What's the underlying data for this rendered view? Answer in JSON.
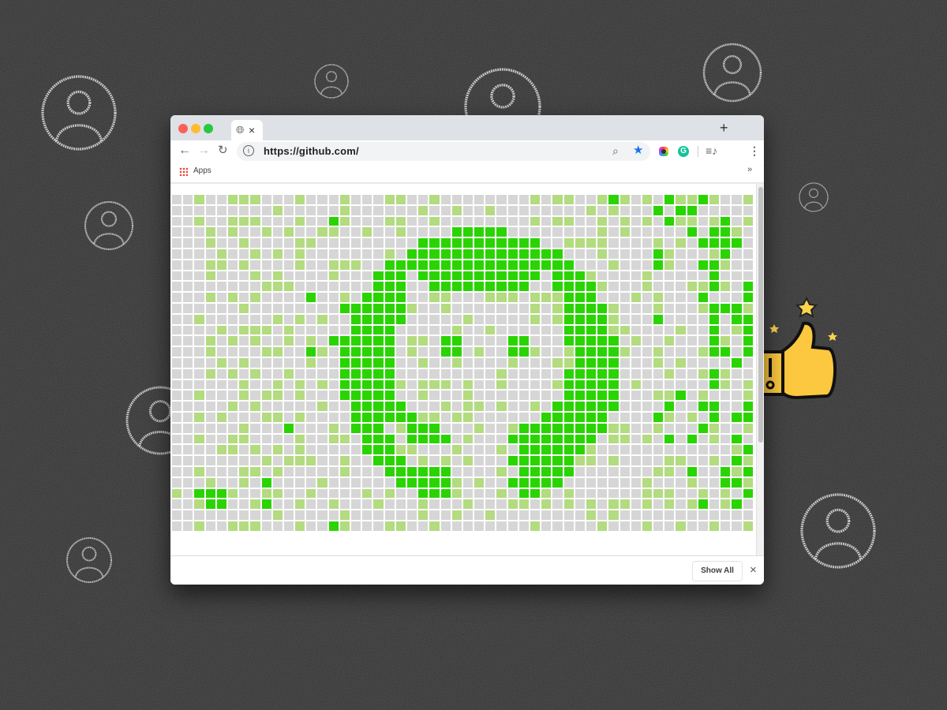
{
  "browser": {
    "tab_close": "×",
    "new_tab": "+",
    "url": "https://github.com/",
    "bookmarks": {
      "apps_label": "Apps",
      "more": "»"
    },
    "bottom_bar": {
      "show_all_label": "Show All",
      "close": "×"
    }
  },
  "colors": {
    "empty": "#d6d6d6",
    "light": "#b3db80",
    "bright": "#2ad400",
    "traffic_close": "#ff5f57",
    "traffic_min": "#febc2e",
    "traffic_max": "#28c840",
    "bookmark_star": "#1a73e8"
  },
  "icons": [
    "globe-icon",
    "back-arrow-icon",
    "forward-arrow-icon",
    "reload-icon",
    "info-icon",
    "zoom-icon",
    "bookmark-star-icon",
    "extension-color-icon",
    "grammarly-icon",
    "media-playlist-icon",
    "menu-kebab-icon",
    "apps-grid-icon",
    "user-circle-icon",
    "thumbs-up-icon"
  ],
  "contribution_grid": {
    "rows": [
      "0010011100010001000110010000000010110012101021121001",
      "0000000001000001000000100100100000000101000202200000",
      "0010011100010021000110010000000010110010101021101201",
      "0001010010100110010010000222220000000010100000202210",
      "0001001000011000000000222222222220011110000101022220",
      "0000100101010000000102222222222222200010000210001200",
      "0001101000010011100222222222222222220001000210022100",
      "0001000101000010002220222222222220222100001000002000",
      "0000000011100000002220022222222200222210001000112102",
      "0001010100002001022220011000111011122200010100020002",
      "0000001000000002222221001000000010122221000100012221",
      "0010000001010100222220000010000010122221000200002022",
      "0000101110100000222200000100100000022221100001002012",
      "0001010100101022222201102200002200022222010010002102",
      "0001000011002102222201002201002210012222100100012202",
      "0000101000001002222200100100001000112222000101000020",
      "0001010100100002222200000000010000022222000010012100",
      "0000001001010102222210111010010000122222010000002101",
      "0010001011010002222200100010000000022222000112010001",
      "0000010100000100222220001011010010222222000020022002",
      "0010100011010000222222110110000002222220000210102022",
      "0000001000200010222012220001001222222221100100021001",
      "0010011000010011022202222010002222222201101020201020",
      "0000110101010000022211000100010222222100000000000012",
      "0000000010111001002220101010002222221101000011001021",
      "0010001101000001000222222000010222220000000110200212",
      "0001001020000100000022222101002222200000001000100221",
      "1022210011001000010100222100010221010000001110010102",
      "0012200120010010001000100010001101010101101010120120",
      "0000000001000001000000100100100000000101000000000000",
      "0010011100010021000110010000000010000010001001001001"
    ]
  }
}
